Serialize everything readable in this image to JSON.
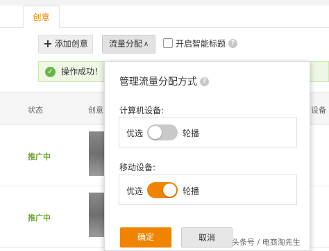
{
  "tabs": {
    "active_label": "创意"
  },
  "toolbar": {
    "add_label": "添加创意",
    "flow_label": "流量分配",
    "flow_caret": "∧",
    "smart_title_label": "开启智能标题",
    "help_glyph": "?"
  },
  "notice": {
    "message": "操作成功！",
    "ok_glyph": "✓"
  },
  "table": {
    "headers": [
      "状态",
      "创意",
      "设备"
    ],
    "rows": [
      {
        "status": "推广中"
      },
      {
        "status": "推广中"
      }
    ]
  },
  "popup": {
    "title": "管理流量分配方式",
    "computer": {
      "label": "计算机设备:",
      "left": "优选",
      "right": "轮播",
      "checked": false
    },
    "mobile": {
      "label": "移动设备:",
      "left": "优选",
      "right": "轮播",
      "checked": true
    },
    "ok_label": "确定",
    "cancel_label": "取消"
  },
  "watermark": "头条号 / 电商淘先生",
  "colors": {
    "accent": "#f08300",
    "status_green": "#6aa62c",
    "success_bg": "#eef7e4"
  },
  "icons": {
    "add": "plus-icon",
    "help": "question-icon",
    "ok": "check-circle-icon"
  }
}
